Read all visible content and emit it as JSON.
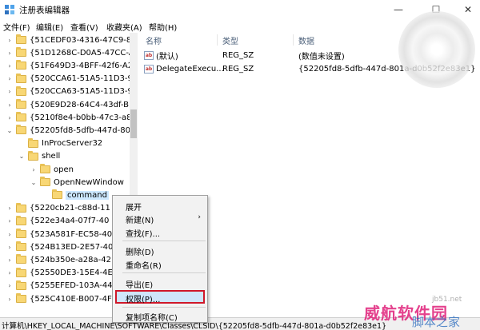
{
  "window": {
    "title": "注册表编辑器",
    "minimize": "—",
    "maximize": "☐",
    "close": "✕"
  },
  "menu": [
    "文件(F)",
    "编辑(E)",
    "查看(V)",
    "收藏夹(A)",
    "帮助(H)"
  ],
  "tree": [
    {
      "label": "{51CEDF03-4316-47C9-81",
      "expander": "›",
      "indent": 0
    },
    {
      "label": "{51D1268C-D0A5-47CC-A",
      "expander": "›",
      "indent": 0
    },
    {
      "label": "{51F649D3-4BFF-42f6-A25",
      "expander": "›",
      "indent": 0
    },
    {
      "label": "{520CCA61-51A5-11D3-91",
      "expander": "›",
      "indent": 0
    },
    {
      "label": "{520CCA63-51A5-11D3-91",
      "expander": "›",
      "indent": 0
    },
    {
      "label": "{520E9D28-64C4-43df-BE",
      "expander": "›",
      "indent": 0
    },
    {
      "label": "{5210f8e4-b0bb-47c3-a8",
      "expander": "›",
      "indent": 0
    },
    {
      "label": "{52205fd8-5dfb-447d-801",
      "expander": "⌄",
      "indent": 0
    },
    {
      "label": "InProcServer32",
      "expander": "",
      "indent": 1
    },
    {
      "label": "shell",
      "expander": "⌄",
      "indent": 1
    },
    {
      "label": "open",
      "expander": "›",
      "indent": 2
    },
    {
      "label": "OpenNewWindow",
      "expander": "⌄",
      "indent": 2
    },
    {
      "label": "command",
      "expander": "",
      "indent": 3,
      "selected": true
    },
    {
      "label": "{5220cb21-c88d-11",
      "expander": "›",
      "indent": 0
    },
    {
      "label": "{522e34a4-07f7-40",
      "expander": "›",
      "indent": 0
    },
    {
      "label": "{523A581F-EC58-40",
      "expander": "›",
      "indent": 0
    },
    {
      "label": "{524B13ED-2E57-40",
      "expander": "›",
      "indent": 0
    },
    {
      "label": "{524b350e-a28a-42",
      "expander": "›",
      "indent": 0
    },
    {
      "label": "{52550DE3-15E4-4E",
      "expander": "›",
      "indent": 0
    },
    {
      "label": "{5255EFED-103A-44",
      "expander": "›",
      "indent": 0
    },
    {
      "label": "{525C410E-B007-4F",
      "expander": "›",
      "indent": 0
    }
  ],
  "columns": {
    "name": "名称",
    "type": "类型",
    "data": "数据"
  },
  "values": [
    {
      "icon": "ab",
      "name": "(默认)",
      "type": "REG_SZ",
      "data": "(数值未设置)"
    },
    {
      "icon": "ab",
      "name": "DelegateExecu...",
      "type": "REG_SZ",
      "data": "{52205fd8-5dfb-447d-801a-d0b52f2e83e1}"
    }
  ],
  "context_menu": {
    "items": [
      {
        "label": "展开",
        "submenu": false
      },
      {
        "label": "新建(N)",
        "submenu": true
      },
      {
        "label": "查找(F)...",
        "submenu": false
      },
      {
        "label": "删除(D)",
        "submenu": false
      },
      {
        "label": "重命名(R)",
        "submenu": false
      },
      {
        "label": "导出(E)",
        "submenu": false
      },
      {
        "label": "权限(P)...",
        "submenu": false,
        "highlighted": true
      },
      {
        "label": "复制项名称(C)",
        "submenu": false
      }
    ],
    "highlight_color": "#d0182a"
  },
  "status": "计算机\\HKEY_LOCAL_MACHINE\\SOFTWARE\\Classes\\CLSID\\{52205fd8-5dfb-447d-801a-d0b52f2e83e1}",
  "watermark": {
    "main": "威航软件园",
    "small": "jb51.net",
    "sub": "脚本之家"
  }
}
